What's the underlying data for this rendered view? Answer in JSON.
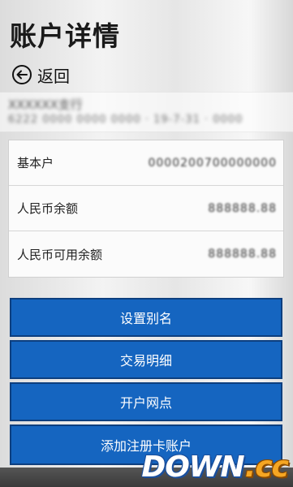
{
  "header": {
    "title": "账户详情",
    "back_label": "返回"
  },
  "account": {
    "name": "XXXXXX支行",
    "number": "6222 0000 0000 0000 · 19-7-31 · 0000"
  },
  "details": [
    {
      "label": "基本户",
      "value": "0000200700000000"
    },
    {
      "label": "人民币余额",
      "value": "888888.88"
    },
    {
      "label": "人民币可用余额",
      "value": "888888.88"
    }
  ],
  "actions": {
    "set_alias": "设置别名",
    "transaction_details": "交易明细",
    "opening_branch": "开户网点",
    "add_registered_card": "添加注册卡账户"
  },
  "watermark": {
    "main": "DOWN",
    "suffix": ".cc"
  },
  "colors": {
    "button_blue": "#1565c0",
    "button_border": "#0d3f7f"
  }
}
